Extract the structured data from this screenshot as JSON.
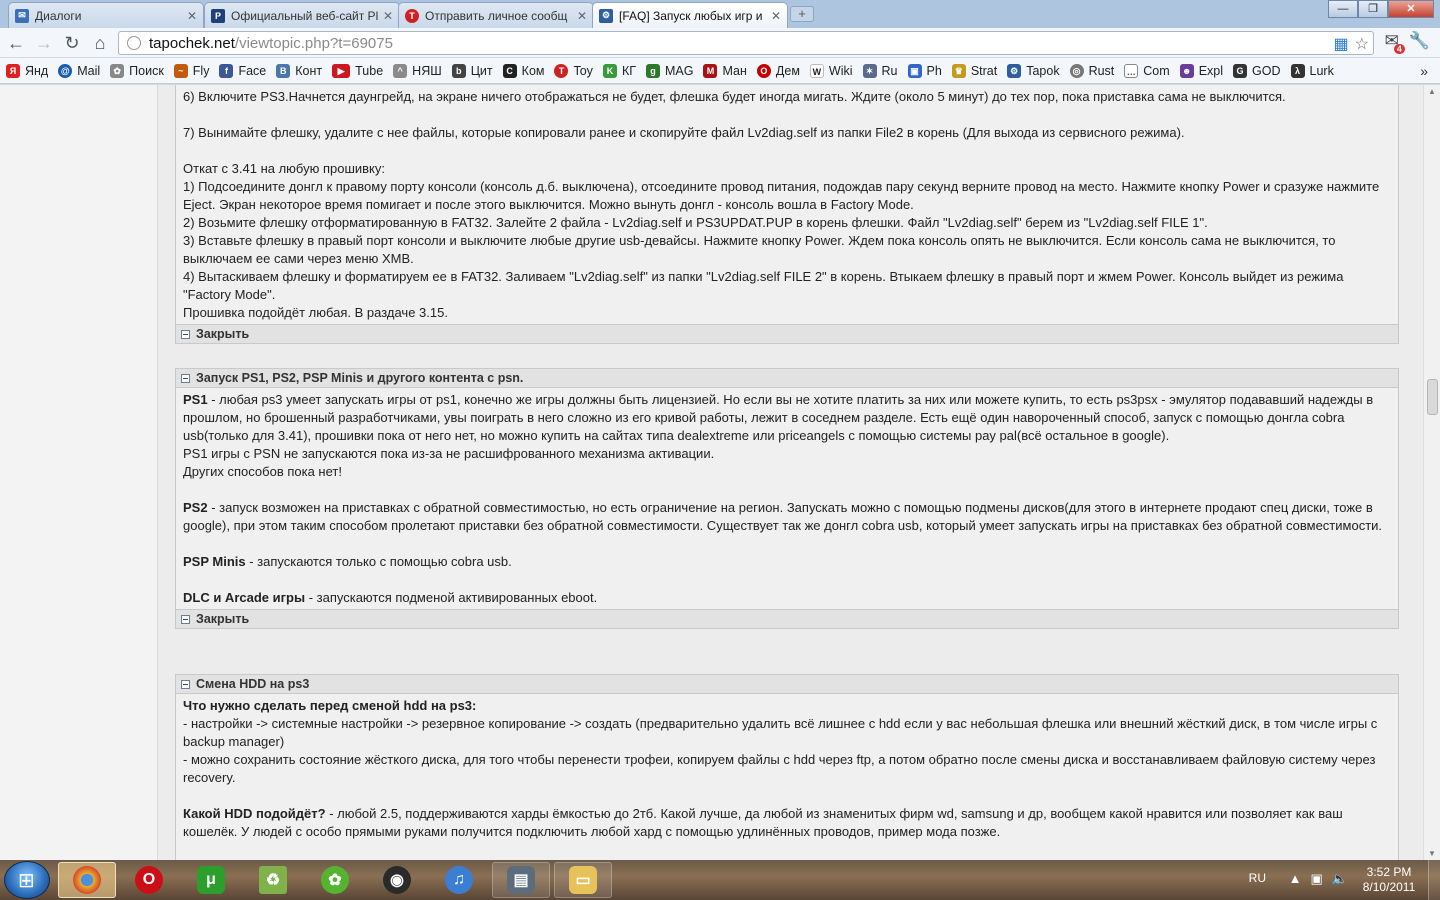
{
  "tabs": [
    {
      "title": "Диалоги",
      "icon": "chat-icon",
      "color": "#3b6fb6"
    },
    {
      "title": "Официальный веб-сайт Pl",
      "icon": "playstation-icon",
      "color": "#1e3f7a"
    },
    {
      "title": "Отправить личное сообщ",
      "icon": "tapochek-icon",
      "color": "#cc2222"
    },
    {
      "title": "[FAQ] Запуск любых игр и",
      "icon": "forum-icon",
      "color": "#2d5f9e"
    }
  ],
  "address": {
    "host": "tapochek.net",
    "path": "/viewtopic.php?t=69075"
  },
  "mail_badge": "4",
  "bookmarks": [
    {
      "label": "Янд",
      "icon": "yandex-icon",
      "color": "#e02020"
    },
    {
      "label": "Mail",
      "icon": "mail-icon",
      "color": "#1a5cb0"
    },
    {
      "label": "Поиск",
      "icon": "search-icon",
      "color": "#888888"
    },
    {
      "label": "Fly",
      "icon": "fly-icon",
      "color": "#c45a0c"
    },
    {
      "label": "Face",
      "icon": "facebook-icon",
      "color": "#3b5998"
    },
    {
      "label": "Конт",
      "icon": "vkontakte-icon",
      "color": "#4a76a8"
    },
    {
      "label": "Tube",
      "icon": "youtube-icon",
      "color": "#cc181e"
    },
    {
      "label": "НЯШ",
      "icon": "nyash-icon",
      "color": "#8a8a8a"
    },
    {
      "label": "Цит",
      "icon": "bash-icon",
      "color": "#444444"
    },
    {
      "label": "Ком",
      "icon": "comics-icon",
      "color": "#222222"
    },
    {
      "label": "Toy",
      "icon": "tapochek-icon",
      "color": "#cc2222"
    },
    {
      "label": "КГ",
      "icon": "kg-icon",
      "color": "#3a9a3a"
    },
    {
      "label": "MAG",
      "icon": "mag-icon",
      "color": "#2a7a2a"
    },
    {
      "label": "Ман",
      "icon": "manga-icon",
      "color": "#aa1111"
    },
    {
      "label": "Дем",
      "icon": "opera-icon",
      "color": "#c40000"
    },
    {
      "label": "Wiki",
      "icon": "wikipedia-icon",
      "color": "#555555"
    },
    {
      "label": "Ru",
      "icon": "ru-icon",
      "color": "#5a6a8a"
    },
    {
      "label": "Ph",
      "icon": "photo-icon",
      "color": "#3366cc"
    },
    {
      "label": "Strat",
      "icon": "trophy-icon",
      "color": "#c59a1c"
    },
    {
      "label": "Tapok",
      "icon": "forum-icon",
      "color": "#2d5f9e"
    },
    {
      "label": "Rust",
      "icon": "rust-icon",
      "color": "#777777"
    },
    {
      "label": "Com",
      "icon": "speech-bubble-icon",
      "color": "#666666"
    },
    {
      "label": "Expl",
      "icon": "explosm-icon",
      "color": "#6a3d9a"
    },
    {
      "label": "GOD",
      "icon": "google-icon",
      "color": "#333333"
    },
    {
      "label": "Lurk",
      "icon": "lambda-icon",
      "color": "#333333"
    }
  ],
  "post": {
    "top_lines": [
      "6) Включите PS3.Начнется даунгрейд, на экране ничего отображаться не будет, флешка будет иногда мигать. Ждите (около 5 минут) до тех пор, пока приставка сама не выключится.",
      "",
      "7) Вынимайте флешку, удалите с нее файлы, которые копировали ранее и скопируйте файл Lv2diag.self из папки File2 в корень (Для выхода из сервисного режима).",
      "",
      "Откат с 3.41 на любую прошивку:",
      "1) Подсоедините донгл к правому порту консоли (консоль д.б. выключена), отсоедините провод питания, подождав пару секунд верните провод на место. Нажмите кнопку Power и сразуже нажмите Eject. Экран некоторое время помигает и после этого выключится. Можно вынуть донгл - консоль вошла в Factory Mode.",
      "2) Возьмите флешку отформатированную в FAT32. Залейте 2 файла - Lv2diag.self и PS3UPDAT.PUP в корень флешки. Файл \"Lv2diag.self\" берем из \"Lv2diag.self FILE 1\".",
      "3) Вставьте флешку в правый порт консоли и выключите любые другие usb-девайсы. Нажмите кнопку Power. Ждем пока консоль опять не выключится. Если консоль сама не выключится, то выключаем ее сами через меню XMB.",
      "4) Вытаскиваем флешку и форматируем ее в FAT32. Заливаем \"Lv2diag.self\" из папки \"Lv2diag.self FILE 2\" в корень. Втыкаем флешку в правый порт и жмем Power. Консоль выйдет из режима \"Factory Mode\".",
      "Прошивка подойдёт любая. В раздаче 3.15."
    ],
    "close_label": "Закрыть",
    "section2": {
      "title": "Запуск PS1, PS2, PSP Minis и другого контента с psn.",
      "ps1_bold": "PS1",
      "ps1_text": " - любая ps3 умеет запускать игры от ps1, конечно же игры должны быть лицензией. Но если вы не хотите платить за них или можете купить, то есть ps3psx - эмулятор подававший надежды в прошлом, но брошенный разработчиками, увы поиграть в него сложно из его кривой работы, лежит в соседнем разделе. Есть ещё один навороченный способ, запуск с помощью донгла cobra usb(только для 3.41), прошивки пока от него нет, но можно купить на сайтах типа dealextreme или priceangels с помощью системы pay pal(всё остальное в google).",
      "ps1_line2": "PS1 игры с PSN не запускаются пока из-за не расшифрованного механизма активации.",
      "ps1_line3": "Других способов пока нет!",
      "ps2_bold": "PS2",
      "ps2_text": " - запуск возможен на приставках с обратной совместимостью, но есть ограничение на регион. Запускать можно с помощью подмены дисков(для этого в интернете продают спец диски, тоже в google), при этом таким способом пролетают приставки без обратной совместимости. Существует так же донгл cobra usb, который умеет запускать игры на приставках без обратной совместимости.",
      "psp_bold": "PSP Minis",
      "psp_text": " - запускаются только с помощью cobra usb.",
      "dlc_bold": "DLC и Arcade игры",
      "dlc_text": " - запускаются подменой активированных eboot."
    },
    "section3": {
      "title": "Смена HDD на ps3",
      "q1_bold": "Что нужно сделать перед сменой hdd на ps3:",
      "q1_line1": "- настройки -> системные настройки -> резервное копирование -> создать (предварительно удалить всё лишнее с hdd если у вас небольшая флешка или внешний жёсткий диск, в том числе игры с backup manager)",
      "q1_line2": "- можно сохранить состояние жёсткого диска, для того чтобы перенести трофеи, копируем файлы с hdd через ftp, а потом обратно после смены диска и восстанавливаем файловую систему через recovery.",
      "q2_bold": "Какой HDD подойдёт?",
      "q2_text": " - любой 2.5, поддерживаются харды ёмкостью до 2тб. Какой лучше, да любой из знаменитых фирм wd, samsung и др, вообщем какой нравится или позволяет как ваш кошелёк. У людей с особо прямыми руками получится подключить любой хард с помощью удлинённых проводов, пример мода позже."
    }
  },
  "taskbar": {
    "apps": [
      {
        "name": "chrome",
        "icon": "chrome-icon",
        "color": "#e8b02a"
      },
      {
        "name": "opera",
        "icon": "opera-icon",
        "color": "#cc0f16"
      },
      {
        "name": "utorrent",
        "icon": "utorrent-icon",
        "color": "#2b9e2b"
      },
      {
        "name": "recycle",
        "icon": "recycle-bin-icon",
        "color": "#7fb24a"
      },
      {
        "name": "icq",
        "icon": "icq-icon",
        "color": "#55b42f"
      },
      {
        "name": "steam",
        "icon": "steam-icon",
        "color": "#2a2a2a"
      },
      {
        "name": "itunes",
        "icon": "itunes-icon",
        "color": "#3b7fd4"
      },
      {
        "name": "gpu-tool",
        "icon": "gpu-tool-icon",
        "color": "#5c6c7c"
      },
      {
        "name": "explorer",
        "icon": "folder-icon",
        "color": "#e7c15a"
      }
    ],
    "lang": "RU",
    "time": "3:52 PM",
    "date": "8/10/2011"
  }
}
